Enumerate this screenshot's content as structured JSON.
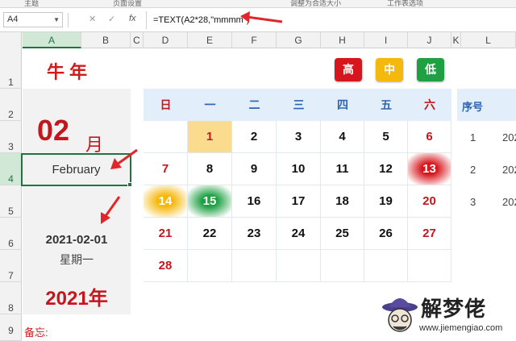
{
  "ribbon": {
    "items": [
      "主题",
      "页面设置",
      "调整为合适大小",
      "工作表选项"
    ]
  },
  "formula_bar": {
    "name_box": "A4",
    "cancel_icon": "✕",
    "enter_icon": "✓",
    "fx_label": "fx",
    "formula": "=TEXT(A2*28,\"mmmm\")"
  },
  "columns": [
    "A",
    "B",
    "C",
    "D",
    "E",
    "F",
    "G",
    "H",
    "I",
    "J",
    "K",
    "L"
  ],
  "rows": [
    "1",
    "2",
    "3",
    "4",
    "5",
    "6",
    "7",
    "8",
    "9"
  ],
  "left_panel": {
    "title": "牛年",
    "month_number": "02",
    "month_suffix": "月",
    "month_name": "February",
    "date": "2021-02-01",
    "weekday": "星期一",
    "year": "2021年",
    "memo": "备忘:"
  },
  "priority_buttons": [
    {
      "label": "高",
      "color": "#d6161d"
    },
    {
      "label": "中",
      "color": "#f5b80d"
    },
    {
      "label": "低",
      "color": "#1fa043"
    }
  ],
  "calendar": {
    "weekdays": [
      "日",
      "一",
      "二",
      "三",
      "四",
      "五",
      "六"
    ],
    "weeks": [
      [
        "",
        "1",
        "2",
        "3",
        "4",
        "5",
        "6"
      ],
      [
        "7",
        "8",
        "9",
        "10",
        "11",
        "12",
        "13"
      ],
      [
        "14",
        "15",
        "16",
        "17",
        "18",
        "19",
        "20"
      ],
      [
        "21",
        "22",
        "23",
        "24",
        "25",
        "26",
        "27"
      ],
      [
        "28",
        "",
        "",
        "",
        "",
        "",
        ""
      ]
    ],
    "highlights": [
      {
        "day": "1",
        "level": "中"
      },
      {
        "day": "13",
        "level": "高"
      },
      {
        "day": "14",
        "level": "中"
      },
      {
        "day": "15",
        "level": "低"
      }
    ]
  },
  "side_table": {
    "header": "序号",
    "rows": [
      {
        "no": "1",
        "value": "202"
      },
      {
        "no": "2",
        "value": "202"
      },
      {
        "no": "3",
        "value": "202"
      }
    ]
  },
  "watermark": {
    "text": "解梦佬",
    "url": "www.jiemengiao.com"
  },
  "colors": {
    "accent_red": "#c4161c",
    "excel_green": "#217346",
    "header_blue": "#e2eef9",
    "panel_grey": "#f2f2f2"
  }
}
